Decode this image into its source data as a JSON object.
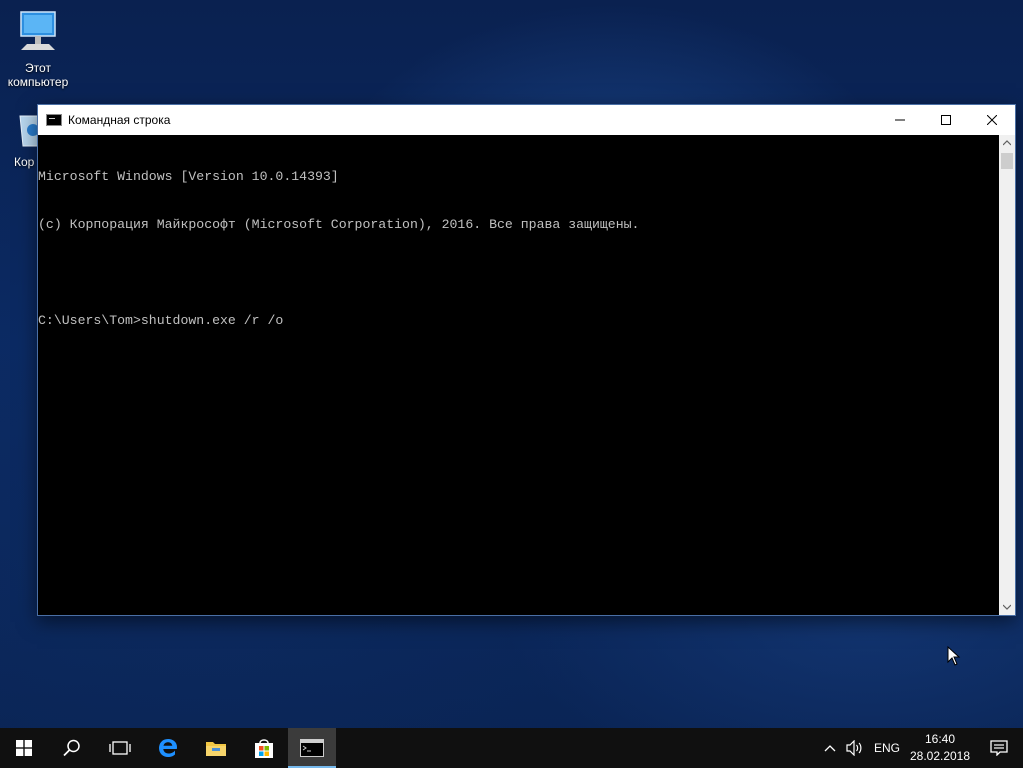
{
  "desktop": {
    "icons": [
      {
        "label": "Этот компьютер",
        "icon": "computer-icon"
      },
      {
        "label": "Кор",
        "icon": "recycle-bin-icon"
      }
    ]
  },
  "window": {
    "title": "Командная строка",
    "icon": "cmd-icon",
    "controls": {
      "minimize": "minimize-icon",
      "maximize": "maximize-icon",
      "close": "close-icon"
    },
    "console_lines": [
      "Microsoft Windows [Version 10.0.14393]",
      "(c) Корпорация Майкрософт (Microsoft Corporation), 2016. Все права защищены.",
      "",
      "C:\\Users\\Tom>shutdown.exe /r /o"
    ]
  },
  "taskbar": {
    "buttons": [
      {
        "name": "start",
        "icon": "windows-logo-icon"
      },
      {
        "name": "search",
        "icon": "search-icon"
      },
      {
        "name": "task-view",
        "icon": "task-view-icon"
      },
      {
        "name": "edge",
        "icon": "edge-icon"
      },
      {
        "name": "file-explorer",
        "icon": "folder-icon"
      },
      {
        "name": "store",
        "icon": "store-icon"
      },
      {
        "name": "command-prompt",
        "icon": "cmd-icon",
        "active": true
      }
    ],
    "tray": {
      "chevron_icon": "chevron-up-icon",
      "volume_icon": "speaker-icon",
      "language": "ENG",
      "time": "16:40",
      "date": "28.02.2018",
      "notifications_icon": "action-center-icon"
    }
  },
  "colors": {
    "console_text": "#c0c0c0",
    "console_bg": "#000000",
    "taskbar_bg": "#101010",
    "active_indicator": "#76b9ed",
    "edge_blue": "#1e90ff",
    "folder_yellow": "#f2c744"
  }
}
